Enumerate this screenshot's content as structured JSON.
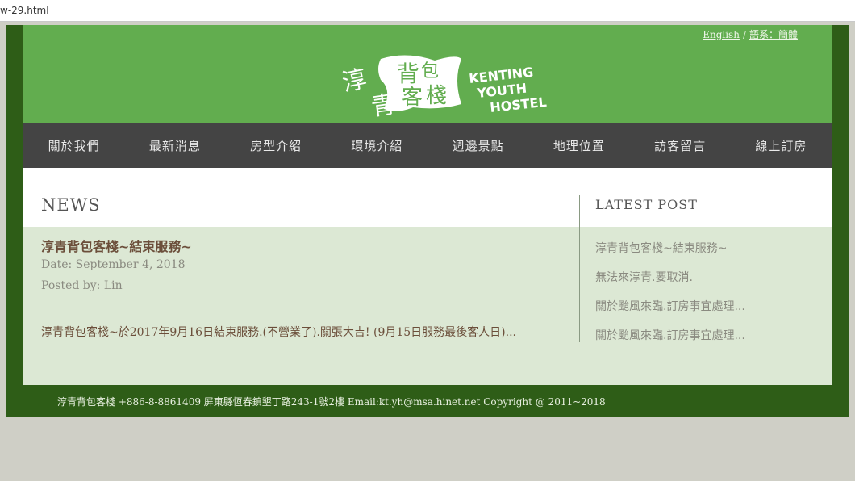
{
  "browser": {
    "url_fragment": "w-29.html"
  },
  "header": {
    "lang_english": "English",
    "lang_sep": "/",
    "lang_switch": "語系：簡體",
    "logo_cn": "淳青背包客棧",
    "logo_en_1": "KENTING",
    "logo_en_2": "YOUTH",
    "logo_en_3": "HOSTEL"
  },
  "nav": {
    "items": [
      "關於我們",
      "最新消息",
      "房型介紹",
      "環境介紹",
      "週邊景點",
      "地理位置",
      "訪客留言",
      "線上訂房"
    ]
  },
  "main": {
    "section_title": "NEWS",
    "post": {
      "title": "淳青背包客棧~結束服務~",
      "date": "Date: September 4, 2018",
      "posted_by": "Posted by: Lin",
      "excerpt": "淳青背包客棧~於2017年9月16日結束服務.(不營業了).關張大吉! (9月15日服務最後客人日)..."
    }
  },
  "sidebar": {
    "title": "LATEST POST",
    "items": [
      "淳青背包客棧~結束服務~",
      "無法來淳青.要取消.",
      "關於颱風來臨.訂房事宜處理...",
      "關於颱風來臨.訂房事宜處理..."
    ]
  },
  "footer": {
    "text": "淳青背包客棧 +886-8-8861409 屏東縣恆春鎮墾丁路243-1號2樓 Email:kt.yh@msa.hinet.net Copyright @ 2011~2018"
  },
  "colors": {
    "frame": "#2e5d17",
    "header_green": "#62ad4f",
    "nav_bg": "#444444",
    "content_bg": "#dce8d4"
  }
}
